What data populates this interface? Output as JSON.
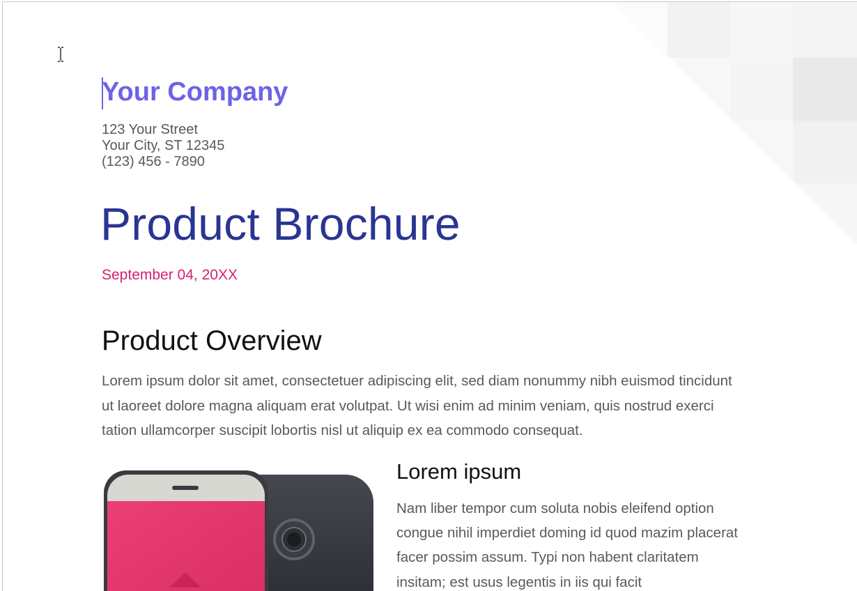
{
  "company": {
    "name": "Your Company",
    "street": "123 Your Street",
    "city": "Your City, ST 12345",
    "phone": "(123) 456 - 7890"
  },
  "document": {
    "title": "Product Brochure",
    "date": "September 04, 20XX"
  },
  "overview": {
    "heading": "Product Overview",
    "body": "Lorem ipsum dolor sit amet, consectetuer adipiscing elit, sed diam nonummy nibh euismod tincidunt ut laoreet dolore magna aliquam erat volutpat. Ut wisi enim ad minim veniam, quis nostrud exerci tation ullamcorper suscipit lobortis nisl ut aliquip ex ea commodo consequat."
  },
  "feature": {
    "heading": "Lorem ipsum",
    "body": "Nam liber tempor cum soluta nobis eleifend option congue nihil imperdiet doming id quod mazim placerat facer possim assum. Typi non habent claritatem insitam; est usus legentis in iis qui facit"
  },
  "colors": {
    "company": "#6d62e8",
    "title": "#2a3592",
    "date": "#d4216f",
    "body_text": "#595959",
    "phone_screen": "#e5386f"
  },
  "icons": {
    "cursor": "text-cursor-icon",
    "image": "smartphone-illustration"
  }
}
